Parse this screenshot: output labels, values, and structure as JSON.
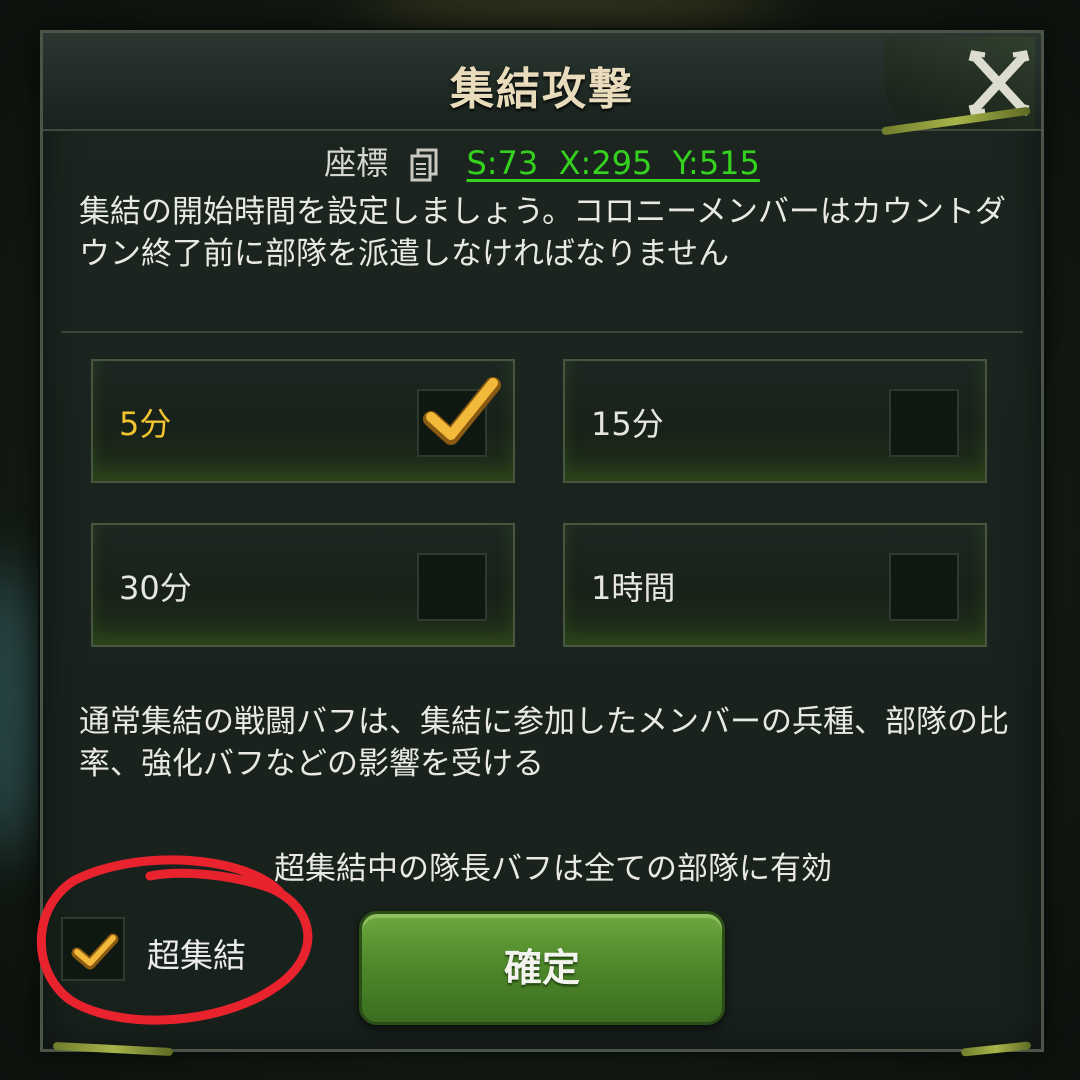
{
  "dialog": {
    "title": "集結攻撃",
    "close_icon": "close-x-icon"
  },
  "coordinates": {
    "label": "座標",
    "copy_icon": "copy-icon",
    "value": "S:73  X:295  Y:515",
    "link_color": "#34d21f"
  },
  "intro_text": "集結の開始時間を設定しましょう。コロニーメンバーはカウントダウン終了前に部隊を派遣しなければなりません",
  "durations": [
    {
      "label": "5分",
      "selected": true
    },
    {
      "label": "15分",
      "selected": false
    },
    {
      "label": "30分",
      "selected": false
    },
    {
      "label": "1時間",
      "selected": false
    }
  ],
  "normal_rally_note": "通常集結の戦闘バフは、集結に参加したメンバーの兵種、部隊の比率、強化バフなどの影響を受ける",
  "super_rally_note": "超集結中の隊長バフは全ての部隊に有効",
  "super_rally": {
    "label": "超集結",
    "checked": true
  },
  "confirm_label": "確定",
  "colors": {
    "selected_text": "#f2c330",
    "check_mark": "#f2b93a",
    "button_green": "#4f8a2b",
    "annotation_red": "#e8232e"
  }
}
